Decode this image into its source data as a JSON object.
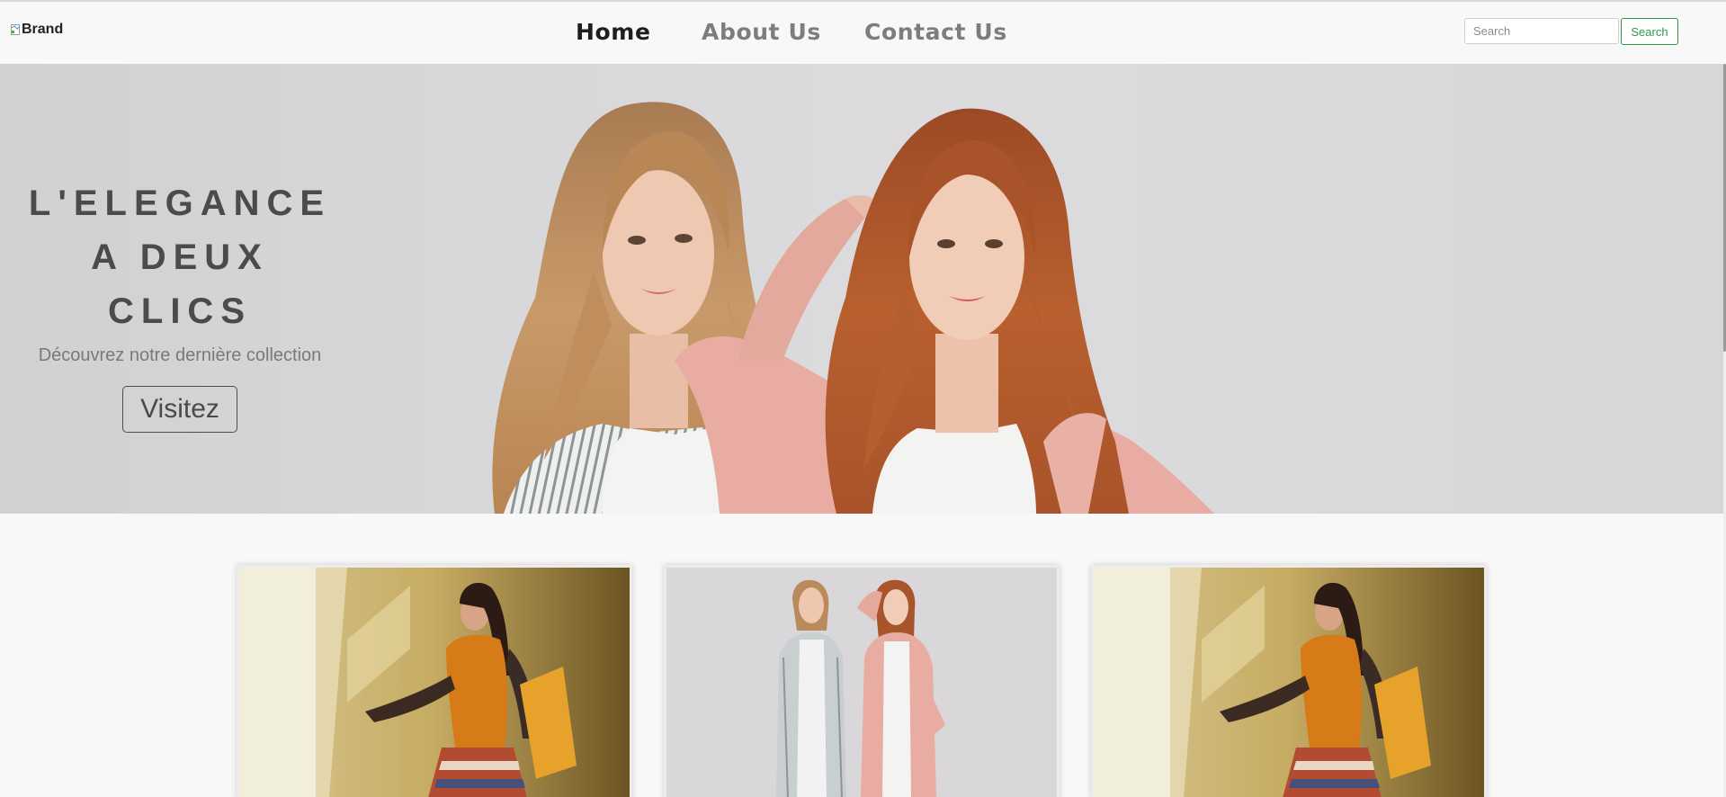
{
  "navbar": {
    "brand_alt": "Brand",
    "links": [
      {
        "label": "Home",
        "active": true
      },
      {
        "label": "About Us",
        "active": false
      },
      {
        "label": "Contact Us",
        "active": false
      }
    ],
    "search": {
      "placeholder": "Search",
      "button_label": "Search"
    }
  },
  "hero": {
    "title_lines": [
      "L'ELEGANCE",
      "A DEUX",
      "CLICS"
    ],
    "subtitle": "Découvrez notre dernière collection",
    "button_label": "Visitez"
  },
  "colors": {
    "search_button": "#2d9a4a",
    "hero_title": "#4a4b4d",
    "nav_active": "#1e1e1e",
    "nav_inactive": "#7d7d7d"
  },
  "cards": [
    {
      "image": "woman-orange-dress-yellow-wall"
    },
    {
      "image": "two-women-fashion-grey-backdrop"
    },
    {
      "image": "woman-orange-dress-yellow-wall"
    }
  ]
}
